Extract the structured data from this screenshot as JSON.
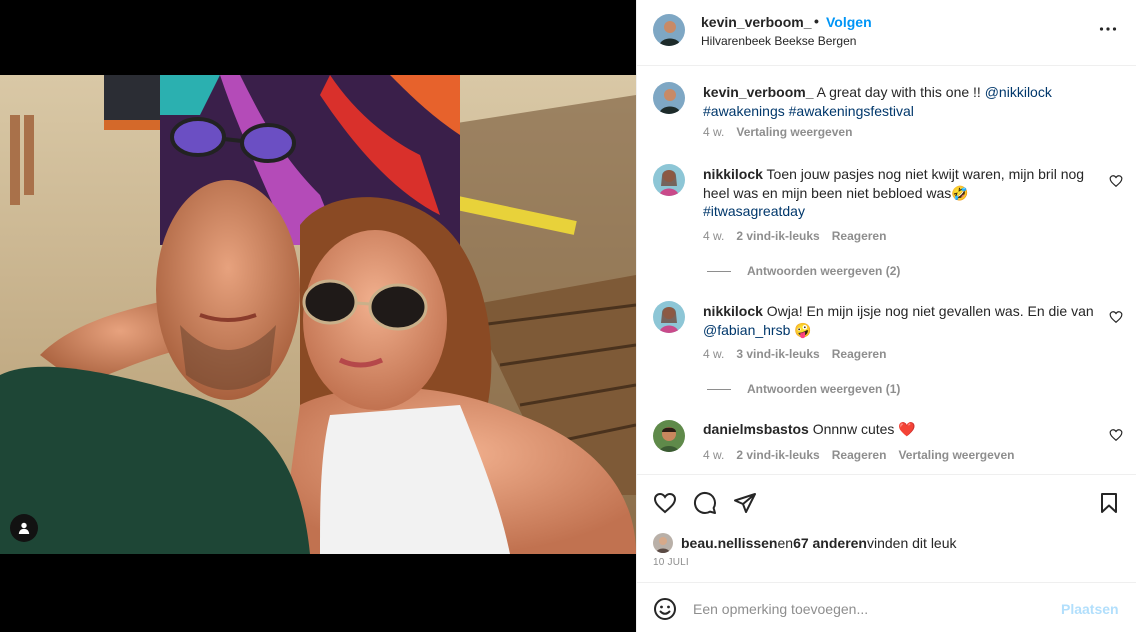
{
  "post": {
    "username": "kevin_verboom_",
    "follow_label": "Volgen",
    "location": "Hilvarenbeek Beekse Bergen",
    "more_icon": "more-options-icon",
    "tag_icon": "user-tag-icon"
  },
  "caption": {
    "username": "kevin_verboom_",
    "text": " A great day with this one !! ",
    "mention": "@nikkilock",
    "tag1": "#awakenings",
    "tag2": "#awakeningsfestival",
    "time": "4 w.",
    "translate": "Vertaling weergeven"
  },
  "comments": [
    {
      "username": "nikkilock",
      "text": " Toen jouw pasjes nog niet kwijt waren, mijn bril nog heel was en mijn been niet bebloed was🤣",
      "hashtag": "#itwasagreatday",
      "time": "4 w.",
      "likes": "2 vind-ik-leuks",
      "reply": "Reageren",
      "view_replies": "Antwoorden weergeven (2)"
    },
    {
      "username": "nikkilock",
      "text": " Owja! En mijn ijsje nog niet gevallen was. En die van ",
      "mention": "@fabian_hrsb",
      "emoji": " 🤪",
      "time": "4 w.",
      "likes": "3 vind-ik-leuks",
      "reply": "Reageren",
      "view_replies": "Antwoorden weergeven (1)"
    },
    {
      "username": "danielmsbastos",
      "text": " Onnnw cutes ❤️",
      "time": "4 w.",
      "likes": "2 vind-ik-leuks",
      "reply": "Reageren",
      "translate": "Vertaling weergeven"
    }
  ],
  "likes": {
    "user": "beau.nellissen",
    "middle": " en ",
    "others": "67 anderen",
    "suffix": " vinden dit leuk"
  },
  "date": "10 JULI",
  "composer": {
    "placeholder": "Een opmerking toevoegen...",
    "post_label": "Plaatsen"
  },
  "colors": {
    "accent": "#0095f6",
    "link": "#00376b",
    "muted": "#8e8e8e",
    "post_disabled": "#b2dffc"
  }
}
